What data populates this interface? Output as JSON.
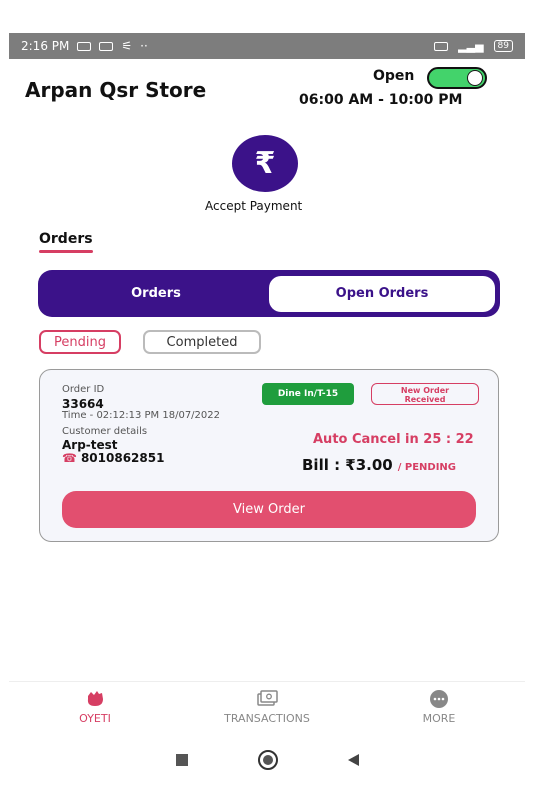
{
  "status_bar": {
    "time": "2:16 PM",
    "battery": "89"
  },
  "header": {
    "store_name": "Arpan Qsr Store",
    "open_label": "Open",
    "hours": "06:00 AM - 10:00 PM"
  },
  "payment": {
    "icon": "rupee-icon",
    "icon_symbol": "₹",
    "label": "Accept Payment"
  },
  "orders_section": {
    "title": "Orders"
  },
  "segmented": {
    "tab1": "Orders",
    "tab2": "Open Orders"
  },
  "filters": {
    "pending": "Pending",
    "completed": "Completed"
  },
  "order_card": {
    "order_id_label": "Order ID",
    "order_id": "33664",
    "time": "Time - 02:12:13 PM 18/07/2022",
    "customer_label": "Customer details",
    "customer_name": "Arp-test",
    "phone": "8010862851",
    "dine_badge": "Dine In/T-15",
    "new_order_badge_line1": "New Order",
    "new_order_badge_line2": "Received",
    "auto_cancel": "Auto Cancel in 25 : 22",
    "bill": "Bill : ₹3.00",
    "bill_status": "/ PENDING",
    "view_button": "View Order"
  },
  "bottom_nav": {
    "item1": "OYETI",
    "item2": "TRANSACTIONS",
    "item3": "MORE"
  },
  "colors": {
    "primary": "#3b1289",
    "accent": "#d63e63",
    "toggle_on": "#43d36b",
    "dine_green": "#1f9d3d"
  }
}
